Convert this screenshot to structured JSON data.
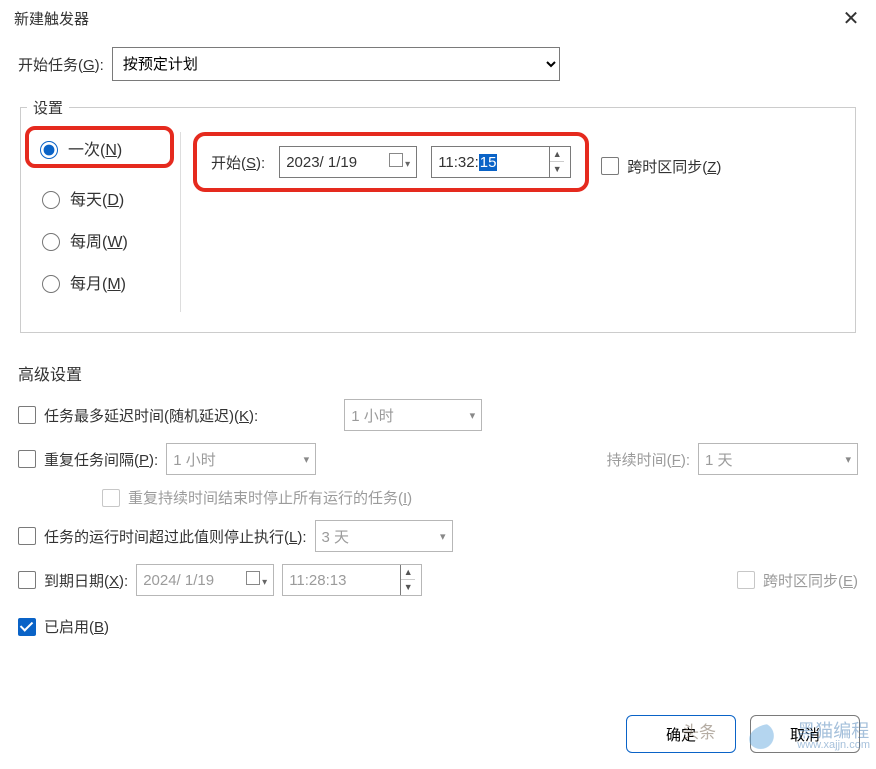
{
  "window": {
    "title": "新建触发器"
  },
  "task": {
    "label_prefix": "开始任务(",
    "hotkey": "G",
    "label_suffix": "):",
    "selected": "按预定计划"
  },
  "settings": {
    "legend": "设置",
    "freq": [
      {
        "label_prefix": "一次(",
        "hotkey": "N",
        "label_suffix": ")",
        "checked": true,
        "highlight": true
      },
      {
        "label_prefix": "每天(",
        "hotkey": "D",
        "label_suffix": ")",
        "checked": false,
        "highlight": false
      },
      {
        "label_prefix": "每周(",
        "hotkey": "W",
        "label_suffix": ")",
        "checked": false,
        "highlight": false
      },
      {
        "label_prefix": "每月(",
        "hotkey": "M",
        "label_suffix": ")",
        "checked": false,
        "highlight": false
      }
    ],
    "start": {
      "label_prefix": "开始(",
      "hotkey": "S",
      "label_suffix": "):",
      "date": "2023/ 1/19",
      "time_prefix": "11:32:",
      "time_selected": "15"
    },
    "sync_tz": {
      "label_prefix": "跨时区同步(",
      "hotkey": "Z",
      "label_suffix": ")"
    }
  },
  "advanced": {
    "title": "高级设置",
    "delay": {
      "label_prefix": "任务最多延迟时间(随机延迟)(",
      "hotkey": "K",
      "label_suffix": "):",
      "value": "1 小时"
    },
    "repeat": {
      "label_prefix": "重复任务间隔(",
      "hotkey": "P",
      "label_suffix": "):",
      "value": "1 小时",
      "duration_label_prefix": "持续时间(",
      "duration_hotkey": "F",
      "duration_label_suffix": "):",
      "duration_value": "1 天",
      "stop_label_prefix": "重复持续时间结束时停止所有运行的任务(",
      "stop_hotkey": "I",
      "stop_label_suffix": ")"
    },
    "stop_after": {
      "label_prefix": "任务的运行时间超过此值则停止执行(",
      "hotkey": "L",
      "label_suffix": "):",
      "value": "3 天"
    },
    "expire": {
      "label_prefix": "到期日期(",
      "hotkey": "X",
      "label_suffix": "):",
      "date": "2024/ 1/19",
      "time": "11:28:13",
      "sync_label_prefix": "跨时区同步(",
      "sync_hotkey": "E",
      "sync_label_suffix": ")"
    },
    "enabled": {
      "label_prefix": "已启用(",
      "hotkey": "B",
      "label_suffix": ")",
      "checked": true
    }
  },
  "buttons": {
    "ok": "确定",
    "cancel": "取消"
  },
  "watermark": {
    "head": "头条",
    "brand": "黑猫编程",
    "site": "www.xajjn.com"
  }
}
